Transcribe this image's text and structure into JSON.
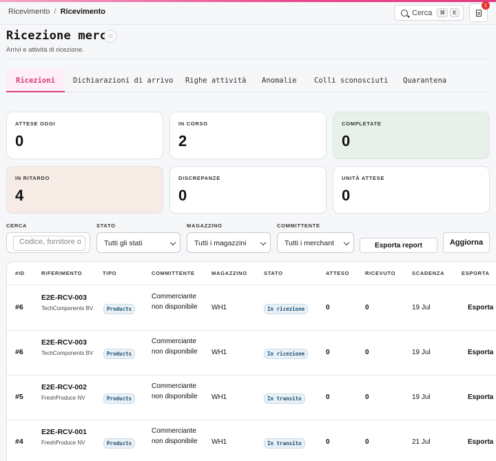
{
  "breadcrumb": {
    "parent": "Ricevimento",
    "separator": "/",
    "current": "Ricevimento"
  },
  "search": {
    "label": "Cerca",
    "key1": "⌘",
    "key2": "K"
  },
  "notifications": {
    "count": "1"
  },
  "page": {
    "title": "Ricezione merci",
    "subtitle": "Arrivi e attività di ricezione."
  },
  "tabs": [
    {
      "label": "Ricezioni",
      "active": true
    },
    {
      "label": "Dichiarazioni di arrivo"
    },
    {
      "label": "Righe attività"
    },
    {
      "label": "Anomalie"
    },
    {
      "label": "Colli sconosciuti"
    },
    {
      "label": "Quarantena"
    }
  ],
  "kpis": [
    {
      "label": "ATTESE OGGI",
      "value": "0"
    },
    {
      "label": "IN CORSO",
      "value": "2"
    },
    {
      "label": "COMPLETATE",
      "value": "0"
    },
    {
      "label": "IN RITARDO",
      "value": "4"
    },
    {
      "label": "DISCREPANZE",
      "value": "0"
    },
    {
      "label": "UNITÀ ATTESE",
      "value": "0"
    }
  ],
  "filters": {
    "search_label": "CERCA",
    "search_placeholder": "Codice, fornitore o",
    "state_label": "STATO",
    "state_value": "Tutti gli stati",
    "warehouse_label": "MAGAZZINO",
    "warehouse_value": "Tutti i magazzini",
    "client_label": "COMMITTENTE",
    "client_value": "Tutti i merchant",
    "export_button": "Esporta report",
    "refresh_button": "Aggiorna"
  },
  "table": {
    "headers": [
      "#ID",
      "RIFERIMENTO",
      "TIPO",
      "COMMITTENTE",
      "MAGAZZINO",
      "STATO",
      "ATTESO",
      "RICEVUTO",
      "SCADENZA",
      "ESPORTA"
    ],
    "rows": [
      {
        "id": "#6",
        "ref": "E2E-RCV-003",
        "supplier": "TechComponents BV",
        "type": "Products",
        "client": "Commerciante non disponibile",
        "warehouse": "WH1",
        "state": "In ricezione",
        "expected": "0",
        "received": "0",
        "due": "19 Jul",
        "action": "Esporta"
      },
      {
        "id": "#6",
        "ref": "E2E-RCV-003",
        "supplier": "TechComponents BV",
        "type": "Products",
        "client": "Commerciante non disponibile",
        "warehouse": "WH1",
        "state": "In ricezione",
        "expected": "0",
        "received": "0",
        "due": "19 Jul",
        "action": "Esporta"
      },
      {
        "id": "#5",
        "ref": "E2E-RCV-002",
        "supplier": "FreshProduce NV",
        "type": "Products",
        "client": "Commerciante non disponibile",
        "warehouse": "WH1",
        "state": "In transito",
        "expected": "0",
        "received": "0",
        "due": "19 Jul",
        "action": "Esporta"
      },
      {
        "id": "#4",
        "ref": "E2E-RCV-001",
        "supplier": "FreshProduce NV",
        "type": "Products",
        "client": "Commerciante non disponibile",
        "warehouse": "WH1",
        "state": "In transito",
        "expected": "0",
        "received": "0",
        "due": "21 Jul",
        "action": "Esporta"
      }
    ]
  }
}
